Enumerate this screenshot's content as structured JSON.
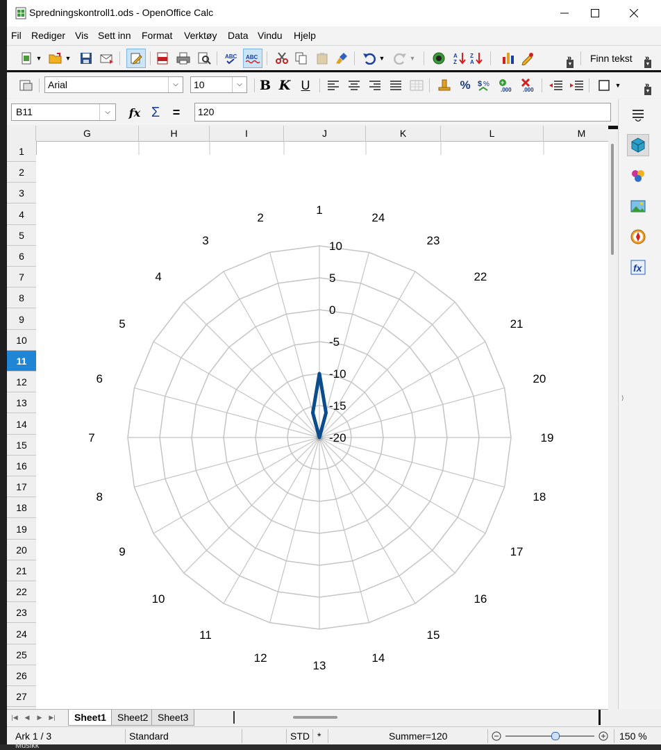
{
  "window": {
    "title": "Spredningskontroll1.ods - OpenOffice Calc"
  },
  "menu": {
    "items": [
      "Fil",
      "Rediger",
      "Vis",
      "Sett inn",
      "Format",
      "Verktøy",
      "Data",
      "Vindu",
      "Hjelp"
    ]
  },
  "toolbar": {
    "find_text": "Finn tekst"
  },
  "formatting": {
    "font_name": "Arial",
    "font_size": "10",
    "bold": "B",
    "italic": "K",
    "underline": "U"
  },
  "formula_bar": {
    "cell_ref": "B11",
    "content": "120"
  },
  "columns": [
    "G",
    "H",
    "I",
    "J",
    "K",
    "L",
    "M"
  ],
  "rows": [
    "1",
    "2",
    "3",
    "4",
    "5",
    "6",
    "7",
    "8",
    "9",
    "10",
    "11",
    "12",
    "13",
    "14",
    "15",
    "16",
    "17",
    "18",
    "19",
    "20",
    "21",
    "22",
    "23",
    "24",
    "25",
    "26",
    "27"
  ],
  "selected_row": "11",
  "sheets": [
    "Sheet1",
    "Sheet2",
    "Sheet3"
  ],
  "active_sheet": "Sheet1",
  "status": {
    "sheet": "Ark 1 / 3",
    "style": "Standard",
    "mode": "STD",
    "modified": "*",
    "sum": "Summer=120",
    "zoom": "150 %"
  },
  "taskbar": {
    "label": "Musikk"
  },
  "colors": {
    "series": "#0b4c8c",
    "grid": "#c4c4c4",
    "selection": "#1f86d6"
  },
  "chart_data": {
    "type": "radar",
    "categories": [
      "1",
      "2",
      "3",
      "4",
      "5",
      "6",
      "7",
      "8",
      "9",
      "10",
      "11",
      "12",
      "13",
      "14",
      "15",
      "16",
      "17",
      "18",
      "19",
      "20",
      "21",
      "22",
      "23",
      "24"
    ],
    "series": [
      {
        "values": [
          -10,
          -16,
          -20,
          -20,
          -20,
          -20,
          -20,
          -20,
          -20,
          -20,
          -20,
          -20,
          -20,
          -20,
          -20,
          -20,
          -20,
          -20,
          -20,
          -20,
          -20,
          -20,
          -20,
          -16
        ]
      }
    ],
    "radial_ticks": [
      "10",
      "5",
      "0",
      "-5",
      "-10",
      "-15",
      "-20"
    ],
    "rlim": [
      -20,
      10
    ],
    "grid": true
  }
}
